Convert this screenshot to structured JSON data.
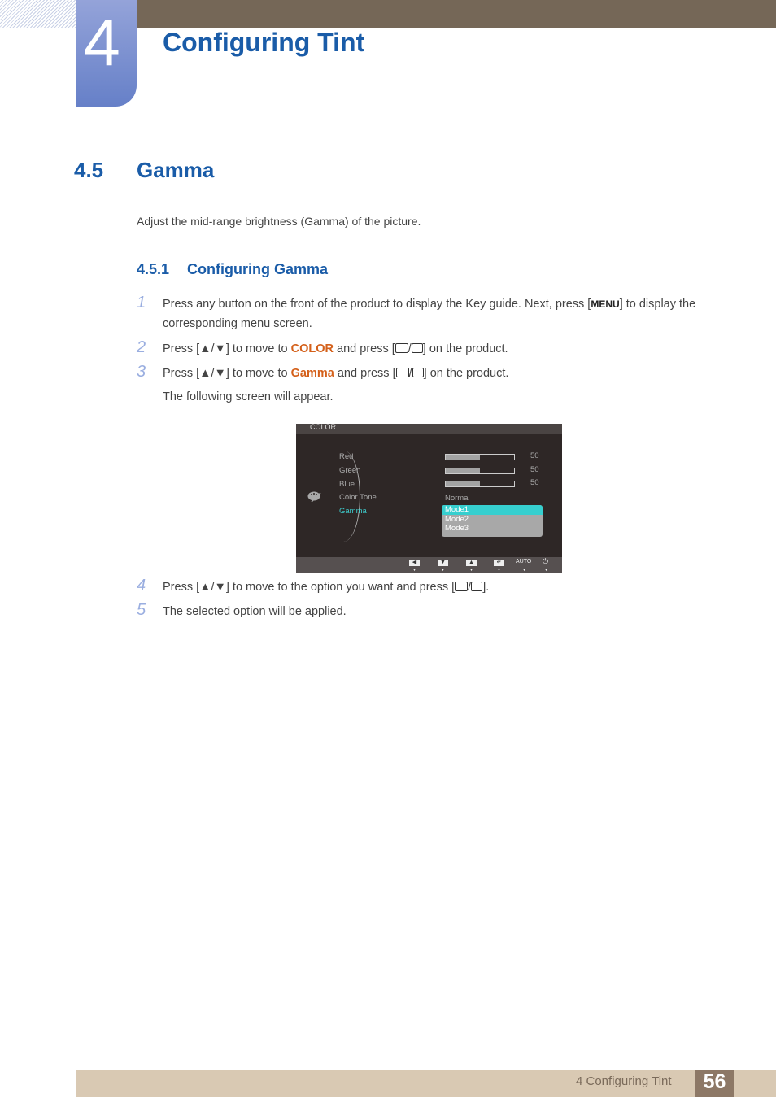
{
  "header": {
    "chapter_number": "4",
    "chapter_title": "Configuring Tint"
  },
  "section": {
    "number": "4.5",
    "title": "Gamma",
    "intro": "Adjust the mid-range brightness (Gamma) of the picture."
  },
  "subsection": {
    "number": "4.5.1",
    "title": "Configuring Gamma"
  },
  "steps": [
    {
      "n": "1",
      "pre": "Press any button on the front of the product to display the Key guide. Next, press [",
      "key": "MENU",
      "post": "] to display the corresponding menu screen."
    },
    {
      "n": "2",
      "pre": "Press [▲/▼] to move to ",
      "highlight": "COLOR",
      "mid": " and press [",
      "post": "] on the product."
    },
    {
      "n": "3",
      "pre": "Press [▲/▼] to move to ",
      "highlight": "Gamma",
      "mid": " and press [",
      "post": "] on the product.",
      "note": "The following screen will appear."
    },
    {
      "n": "4",
      "pre": "Press [▲/▼] to move to the option you want and press [",
      "post": "]."
    },
    {
      "n": "5",
      "text": "The selected option will be applied."
    }
  ],
  "osd": {
    "title": "COLOR",
    "items": [
      {
        "label": "Red",
        "value": "50",
        "level": 0.5
      },
      {
        "label": "Green",
        "value": "50",
        "level": 0.5
      },
      {
        "label": "Blue",
        "value": "50",
        "level": 0.5
      },
      {
        "label": "Color Tone",
        "value": "Normal"
      },
      {
        "label": "Gamma"
      }
    ],
    "gamma_options": [
      "Mode1",
      "Mode2",
      "Mode3"
    ],
    "selected_option": "Mode1",
    "footer_auto": "AUTO",
    "active_color": "#36cfcf"
  },
  "footer": {
    "chapter_label": "4 Configuring Tint",
    "page_number": "56"
  }
}
